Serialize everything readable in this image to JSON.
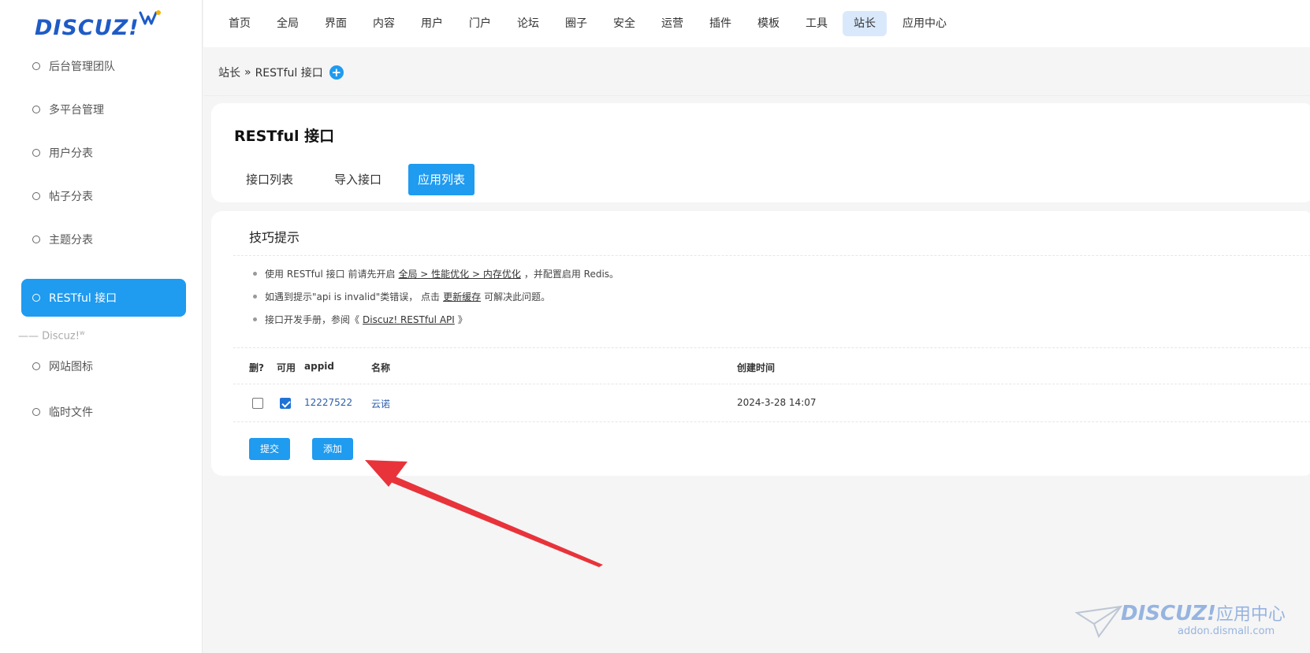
{
  "logo": {
    "text": "DISCUZ!"
  },
  "sidebar": {
    "items": [
      {
        "label": "后台管理团队"
      },
      {
        "label": "多平台管理"
      },
      {
        "label": "用户分表"
      },
      {
        "label": "帖子分表"
      },
      {
        "label": "主题分表"
      },
      {
        "label": "RESTful 接口"
      },
      {
        "label": "网站图标"
      },
      {
        "label": "临时文件"
      }
    ],
    "group_label": "—— Discuz!",
    "group_sup": "w",
    "active_label": "RESTful 接口"
  },
  "topnav": {
    "items": [
      "首页",
      "全局",
      "界面",
      "内容",
      "用户",
      "门户",
      "论坛",
      "圈子",
      "安全",
      "运营",
      "插件",
      "模板",
      "工具",
      "站长",
      "应用中心"
    ],
    "active": "站长"
  },
  "breadcrumb": {
    "parent": "站长",
    "separator": "»",
    "current": "RESTful 接口",
    "add_symbol": "+"
  },
  "page": {
    "title": "RESTful 接口",
    "tabs": [
      "接口列表",
      "导入接口",
      "应用列表"
    ],
    "active_tab": "应用列表"
  },
  "tips": {
    "title": "技巧提示",
    "line1": {
      "before": "使用 RESTful 接口 前请先开启",
      "link": "全局 > 性能优化 > 内存优化",
      "after": "，并配置启用 Redis。"
    },
    "line2": {
      "before": "如遇到提示\"api is invalid\"类错误， 点击",
      "link": "更新缓存",
      "after": "可解决此问题。"
    },
    "line3": {
      "before": "接口开发手册，参阅《",
      "link": "Discuz! RESTful API",
      "after": "》"
    }
  },
  "table": {
    "headers": {
      "delete": "删?",
      "enabled": "可用",
      "appid": "appid",
      "name": "名称",
      "created": "创建时间"
    },
    "rows": [
      {
        "delete": false,
        "enabled": true,
        "appid": "12227522",
        "name": "云诺",
        "created": "2024-3-28 14:07"
      }
    ]
  },
  "buttons": {
    "submit": "提交",
    "add": "添加"
  },
  "watermark": {
    "brand": "DISCUZ!",
    "cn": "应用中心",
    "url": "addon.dismall.com"
  },
  "colors": {
    "accent": "#1f9bf0",
    "arrow": "#e8333a",
    "logo": "#1e5bc6"
  }
}
